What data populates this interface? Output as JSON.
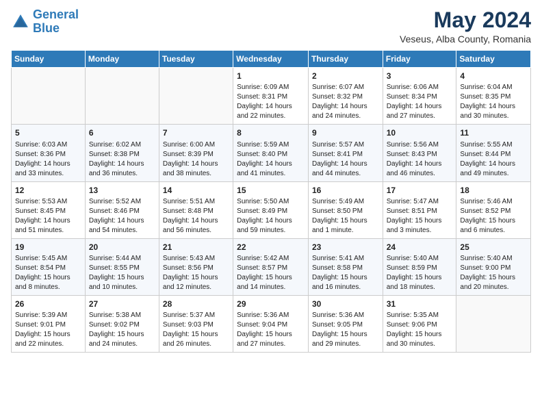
{
  "header": {
    "logo_line1": "General",
    "logo_line2": "Blue",
    "month_title": "May 2024",
    "location": "Veseus, Alba County, Romania"
  },
  "weekdays": [
    "Sunday",
    "Monday",
    "Tuesday",
    "Wednesday",
    "Thursday",
    "Friday",
    "Saturday"
  ],
  "weeks": [
    [
      {
        "day": "",
        "info": ""
      },
      {
        "day": "",
        "info": ""
      },
      {
        "day": "",
        "info": ""
      },
      {
        "day": "1",
        "info": "Sunrise: 6:09 AM\nSunset: 8:31 PM\nDaylight: 14 hours\nand 22 minutes."
      },
      {
        "day": "2",
        "info": "Sunrise: 6:07 AM\nSunset: 8:32 PM\nDaylight: 14 hours\nand 24 minutes."
      },
      {
        "day": "3",
        "info": "Sunrise: 6:06 AM\nSunset: 8:34 PM\nDaylight: 14 hours\nand 27 minutes."
      },
      {
        "day": "4",
        "info": "Sunrise: 6:04 AM\nSunset: 8:35 PM\nDaylight: 14 hours\nand 30 minutes."
      }
    ],
    [
      {
        "day": "5",
        "info": "Sunrise: 6:03 AM\nSunset: 8:36 PM\nDaylight: 14 hours\nand 33 minutes."
      },
      {
        "day": "6",
        "info": "Sunrise: 6:02 AM\nSunset: 8:38 PM\nDaylight: 14 hours\nand 36 minutes."
      },
      {
        "day": "7",
        "info": "Sunrise: 6:00 AM\nSunset: 8:39 PM\nDaylight: 14 hours\nand 38 minutes."
      },
      {
        "day": "8",
        "info": "Sunrise: 5:59 AM\nSunset: 8:40 PM\nDaylight: 14 hours\nand 41 minutes."
      },
      {
        "day": "9",
        "info": "Sunrise: 5:57 AM\nSunset: 8:41 PM\nDaylight: 14 hours\nand 44 minutes."
      },
      {
        "day": "10",
        "info": "Sunrise: 5:56 AM\nSunset: 8:43 PM\nDaylight: 14 hours\nand 46 minutes."
      },
      {
        "day": "11",
        "info": "Sunrise: 5:55 AM\nSunset: 8:44 PM\nDaylight: 14 hours\nand 49 minutes."
      }
    ],
    [
      {
        "day": "12",
        "info": "Sunrise: 5:53 AM\nSunset: 8:45 PM\nDaylight: 14 hours\nand 51 minutes."
      },
      {
        "day": "13",
        "info": "Sunrise: 5:52 AM\nSunset: 8:46 PM\nDaylight: 14 hours\nand 54 minutes."
      },
      {
        "day": "14",
        "info": "Sunrise: 5:51 AM\nSunset: 8:48 PM\nDaylight: 14 hours\nand 56 minutes."
      },
      {
        "day": "15",
        "info": "Sunrise: 5:50 AM\nSunset: 8:49 PM\nDaylight: 14 hours\nand 59 minutes."
      },
      {
        "day": "16",
        "info": "Sunrise: 5:49 AM\nSunset: 8:50 PM\nDaylight: 15 hours\nand 1 minute."
      },
      {
        "day": "17",
        "info": "Sunrise: 5:47 AM\nSunset: 8:51 PM\nDaylight: 15 hours\nand 3 minutes."
      },
      {
        "day": "18",
        "info": "Sunrise: 5:46 AM\nSunset: 8:52 PM\nDaylight: 15 hours\nand 6 minutes."
      }
    ],
    [
      {
        "day": "19",
        "info": "Sunrise: 5:45 AM\nSunset: 8:54 PM\nDaylight: 15 hours\nand 8 minutes."
      },
      {
        "day": "20",
        "info": "Sunrise: 5:44 AM\nSunset: 8:55 PM\nDaylight: 15 hours\nand 10 minutes."
      },
      {
        "day": "21",
        "info": "Sunrise: 5:43 AM\nSunset: 8:56 PM\nDaylight: 15 hours\nand 12 minutes."
      },
      {
        "day": "22",
        "info": "Sunrise: 5:42 AM\nSunset: 8:57 PM\nDaylight: 15 hours\nand 14 minutes."
      },
      {
        "day": "23",
        "info": "Sunrise: 5:41 AM\nSunset: 8:58 PM\nDaylight: 15 hours\nand 16 minutes."
      },
      {
        "day": "24",
        "info": "Sunrise: 5:40 AM\nSunset: 8:59 PM\nDaylight: 15 hours\nand 18 minutes."
      },
      {
        "day": "25",
        "info": "Sunrise: 5:40 AM\nSunset: 9:00 PM\nDaylight: 15 hours\nand 20 minutes."
      }
    ],
    [
      {
        "day": "26",
        "info": "Sunrise: 5:39 AM\nSunset: 9:01 PM\nDaylight: 15 hours\nand 22 minutes."
      },
      {
        "day": "27",
        "info": "Sunrise: 5:38 AM\nSunset: 9:02 PM\nDaylight: 15 hours\nand 24 minutes."
      },
      {
        "day": "28",
        "info": "Sunrise: 5:37 AM\nSunset: 9:03 PM\nDaylight: 15 hours\nand 26 minutes."
      },
      {
        "day": "29",
        "info": "Sunrise: 5:36 AM\nSunset: 9:04 PM\nDaylight: 15 hours\nand 27 minutes."
      },
      {
        "day": "30",
        "info": "Sunrise: 5:36 AM\nSunset: 9:05 PM\nDaylight: 15 hours\nand 29 minutes."
      },
      {
        "day": "31",
        "info": "Sunrise: 5:35 AM\nSunset: 9:06 PM\nDaylight: 15 hours\nand 30 minutes."
      },
      {
        "day": "",
        "info": ""
      }
    ]
  ]
}
